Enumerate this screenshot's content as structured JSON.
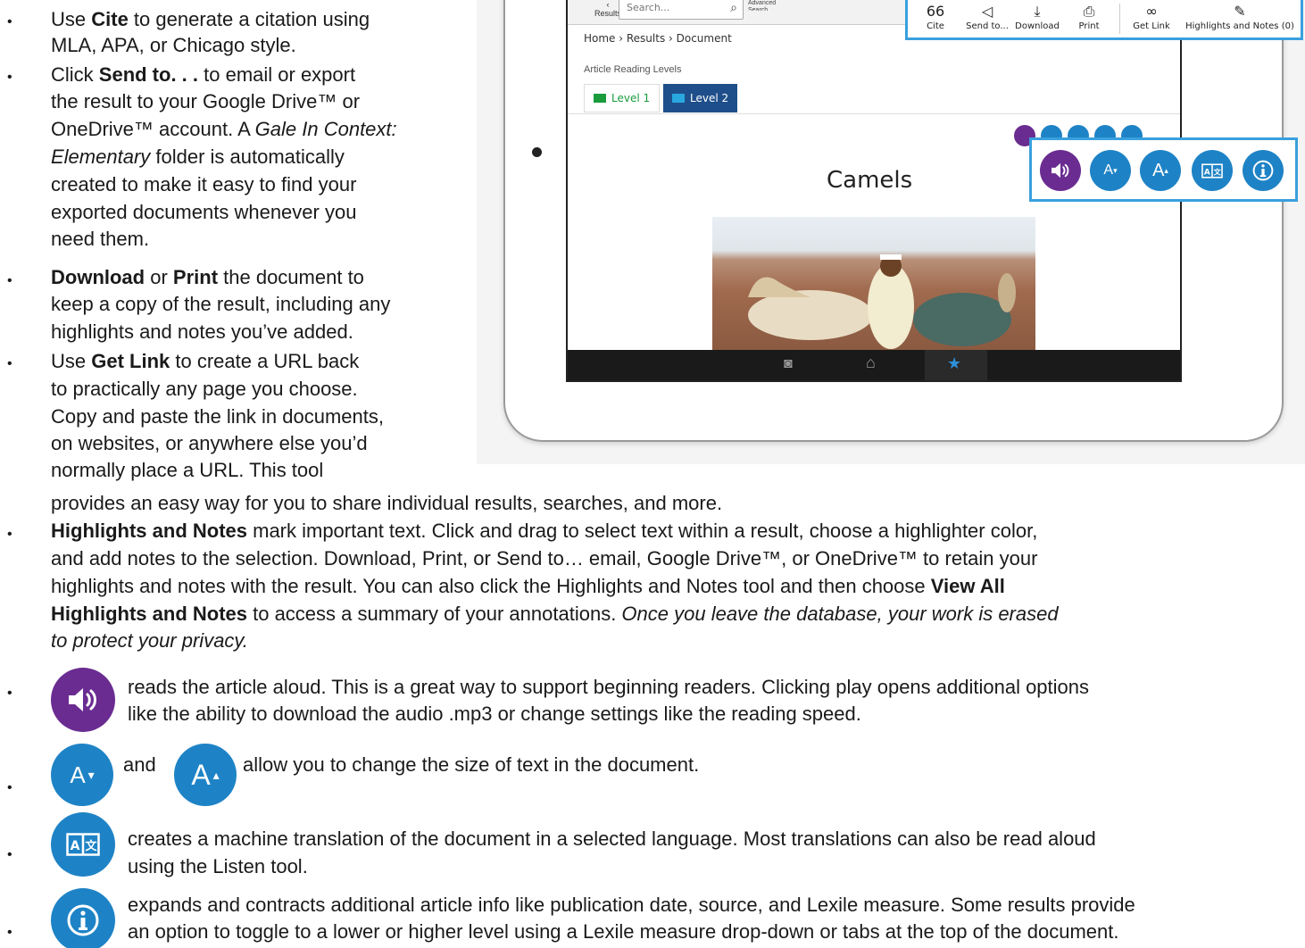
{
  "intro_bullets": [
    {
      "lines": [
        [
          "Use ",
          "b:Cite",
          " to generate a citation using"
        ],
        [
          "MLA, APA, or Chicago style."
        ]
      ]
    },
    {
      "lines": [
        [
          "Click ",
          "b:Send to. . .",
          " to email or export"
        ],
        [
          "the result to your Google Drive™ or"
        ],
        [
          "OneDrive™ account. A ",
          "i:Gale In Context:"
        ],
        [
          "i:Elementary",
          " folder is automatically"
        ],
        [
          "created to make it easy to find your"
        ],
        [
          "exported documents whenever you"
        ],
        [
          "need them."
        ]
      ]
    }
  ],
  "text": {
    "cite_a": "Use ",
    "cite_b": "Cite",
    "cite_c": " to generate a citation using",
    "cite_2": "MLA, APA, or Chicago style.",
    "send_a": "Click ",
    "send_b": "Send to. . .",
    "send_c": " to email or export",
    "send_2": "the result to your Google Drive™ or",
    "send_3a": "OneDrive™ account. A ",
    "send_3b": "Gale In Context:",
    "send_4a": "Elementary",
    "send_4b": " folder is automatically",
    "send_5": "created to make it easy to find your",
    "send_6": "exported documents whenever you",
    "send_7": "need them.",
    "dl_a": "Download",
    "dl_b": " or ",
    "dl_c": "Print",
    "dl_d": " the document to",
    "dl_2": "keep a copy of the result, including any",
    "dl_3": "highlights and notes you’ve added.",
    "gl_a": "Use ",
    "gl_b": "Get Link",
    "gl_c": " to create a URL back",
    "gl_2": "to practically any page you choose.",
    "gl_3": "Copy and paste the link in documents,",
    "gl_4": "on websites, or anywhere else you’d",
    "gl_5": "normally place a URL. This tool",
    "gl_6": "provides an easy way for you to share individual results, searches, and more.",
    "hn_a": "Highlights and Notes",
    "hn_b": " mark important text. Click and drag to select text within a result, choose a highlighter color,",
    "hn_2": "and add notes to the selection. Download, Print, or Send to… email, Google Drive™, or OneDrive™ to retain your",
    "hn_3": "highlights and notes with the result. You can also click the Highlights and Notes tool and then choose ",
    "hn_3b": "View All",
    "hn_4a": "Highlights and Notes",
    "hn_4b": " to access a summary of your annotations. ",
    "hn_4c": "Once you leave the database, your work is erased",
    "hn_5": "to protect your privacy.",
    "listen_1": "reads the article aloud. This is a great way to support beginning readers. Clicking play opens additional options",
    "listen_2": "like the ability to download the audio .mp3 or change settings like the reading speed.",
    "size_and": "and",
    "size_1": "allow you to change the size of text in the document.",
    "tr_1": "creates a machine translation of the document in a selected language. Most translations can also be read aloud",
    "tr_2": "using the Listen tool.",
    "info_1": "expands and contracts additional article info like publication date, source, and Lexile measure. Some results provide",
    "info_2": "an option to toggle to a lower or higher level using a Lexile measure drop-down or tabs at the top of the document.",
    "bullet": "•"
  },
  "ipad": {
    "results": "Results",
    "search_placeholder": "Search...",
    "advanced": "Advanced Search",
    "crumb": "Home › Results › Document",
    "levels_label": "Article Reading Levels",
    "level1": "Level 1",
    "level2": "Level 2",
    "doc_title": "Camels",
    "tools": [
      "Cite",
      "Send to...",
      "Download",
      "Print",
      "Get Link",
      "Highlights and Notes (0)"
    ]
  },
  "colors": {
    "blue": "#1e83c6",
    "purple": "#6a2c91",
    "callout": "#39a0dd",
    "level1": "#1a9b3c",
    "level2_bg": "#1e4f8a"
  }
}
